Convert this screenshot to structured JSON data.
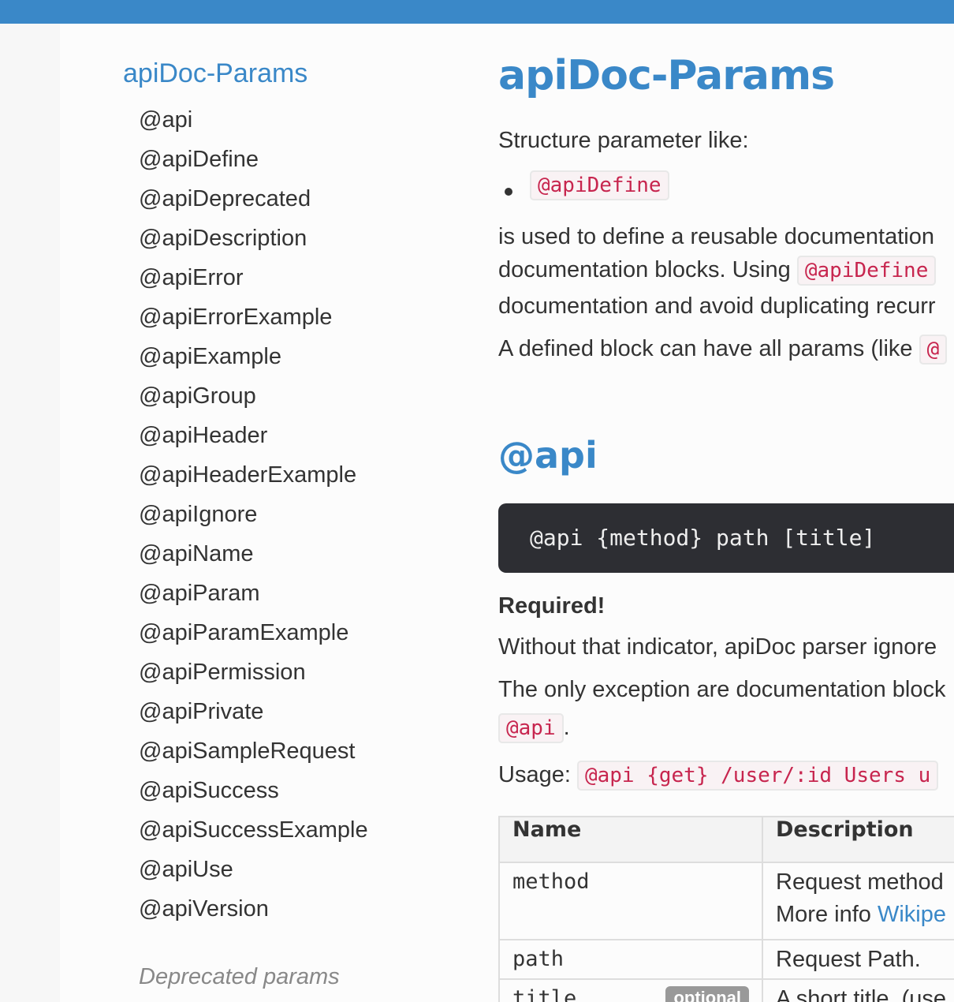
{
  "sidebar": {
    "title": "apiDoc-Params",
    "items": [
      "@api",
      "@apiDefine",
      "@apiDeprecated",
      "@apiDescription",
      "@apiError",
      "@apiErrorExample",
      "@apiExample",
      "@apiGroup",
      "@apiHeader",
      "@apiHeaderExample",
      "@apiIgnore",
      "@apiName",
      "@apiParam",
      "@apiParamExample",
      "@apiPermission",
      "@apiPrivate",
      "@apiSampleRequest",
      "@apiSuccess",
      "@apiSuccessExample",
      "@apiUse",
      "@apiVersion"
    ],
    "deprecated_label": "Deprecated params"
  },
  "main": {
    "title": "apiDoc-Params",
    "intro": "Structure parameter like:",
    "bullet_code": "@apiDefine",
    "para1_line1": "is used to define a reusable documentation",
    "para1_line2_a": "documentation blocks. Using",
    "para1_line2_code": "@apiDefine",
    "para1_line3": "documentation and avoid duplicating recurr",
    "para2_text": "A defined block can have all params (like",
    "para2_code": "@",
    "section": {
      "title": "@api",
      "syntax": "@api {method} path [title]",
      "required": "Required!",
      "line1": "Without that indicator, apiDoc parser ignore",
      "line2": "The only exception are documentation block",
      "line3_code": "@api",
      "line3_rest": ".",
      "usage_label": "Usage:",
      "usage_code": "@api {get} /user/:id Users u"
    },
    "table": {
      "headers": [
        "Name",
        "Description"
      ],
      "rows": [
        {
          "name": "method",
          "desc1": "Request method",
          "desc2_prefix": "More info ",
          "desc2_link": "Wikipe"
        },
        {
          "name": "path",
          "desc1": "Request Path."
        },
        {
          "name": "title",
          "badge": "optional",
          "desc1": "A short title. (use"
        }
      ]
    }
  }
}
